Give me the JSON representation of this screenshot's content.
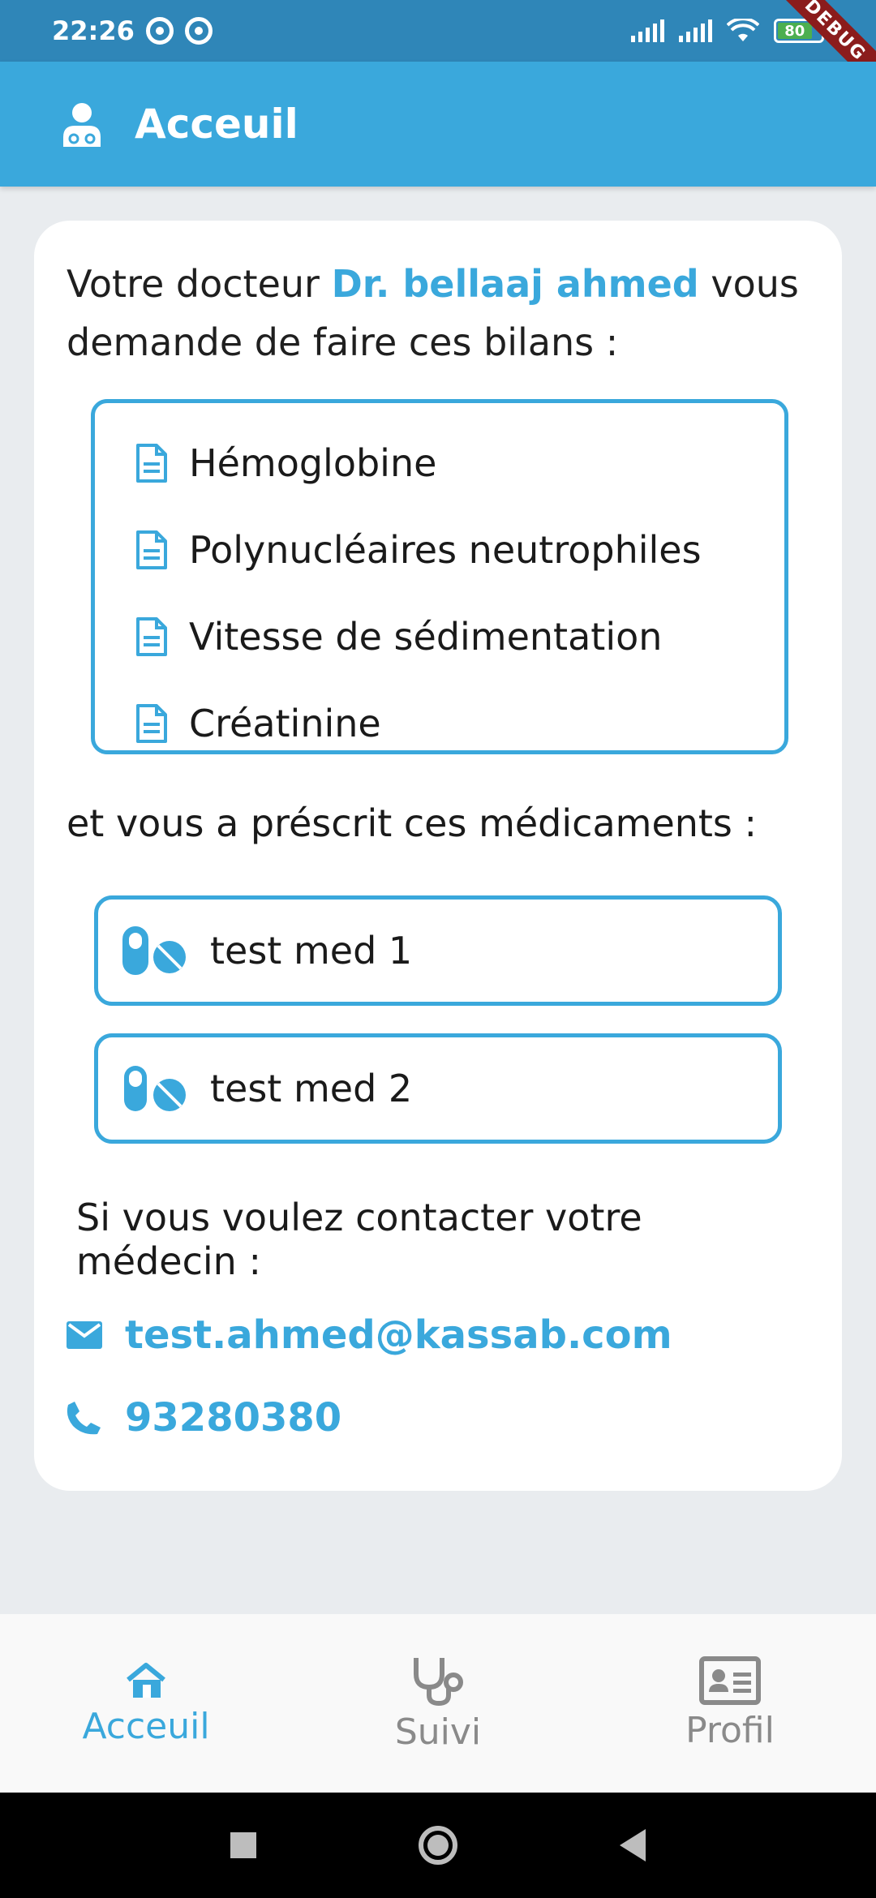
{
  "status_bar": {
    "time": "22:26",
    "battery": "80"
  },
  "debug_banner": "DEBUG",
  "app_bar": {
    "title": "Acceuil"
  },
  "intro": {
    "prefix": "Votre docteur ",
    "doctor": "Dr. bellaaj ahmed",
    "suffix": " vous demande de faire ces bilans :"
  },
  "tests": [
    "Hémoglobine",
    "Polynucléaires neutrophiles",
    "Vitesse de sédimentation",
    "Créatinine"
  ],
  "prescription_label": "et vous a préscrit ces médicaments :",
  "medications": [
    "test med 1",
    "test med 2"
  ],
  "contact": {
    "title": "Si vous voulez contacter votre médecin :",
    "email": "test.ahmed@kassab.com",
    "phone": "93280380"
  },
  "bottom_nav": [
    {
      "label": "Acceuil",
      "icon": "home-icon",
      "active": true
    },
    {
      "label": "Suivi",
      "icon": "stethoscope-icon",
      "active": false
    },
    {
      "label": "Profil",
      "icon": "id-card-icon",
      "active": false
    }
  ],
  "colors": {
    "accent": "#3aa8dc",
    "status_bar": "#2f86b8",
    "background": "#e9ecef"
  }
}
